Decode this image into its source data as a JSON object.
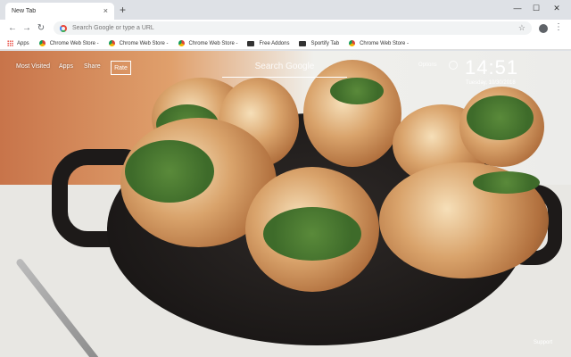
{
  "tab": {
    "title": "New Tab",
    "close": "×",
    "new_tab": "+"
  },
  "window_controls": {
    "minimize": "—",
    "maximize": "☐",
    "close": "✕"
  },
  "toolbar": {
    "back": "←",
    "forward": "→",
    "reload": "↻",
    "omnibox_placeholder": "Search Google or type a URL",
    "star": "☆",
    "menu": "⋮"
  },
  "bookmarks": [
    {
      "label": "Apps",
      "icon": "apps-grid-icon"
    },
    {
      "label": "Chrome Web Store -",
      "icon": "chrome-web-store-icon"
    },
    {
      "label": "Chrome Web Store -",
      "icon": "chrome-web-store-icon"
    },
    {
      "label": "Chrome Web Store -",
      "icon": "chrome-web-store-icon"
    },
    {
      "label": "Free Addons",
      "icon": "addons-icon"
    },
    {
      "label": "Sportify Tab",
      "icon": "sportify-icon"
    },
    {
      "label": "Chrome Web Store -",
      "icon": "chrome-web-store-icon"
    }
  ],
  "newtab": {
    "links": {
      "most_visited": "Most Visited",
      "apps": "Apps",
      "share": "Share",
      "rate": "Rate"
    },
    "search_label": "Search Google",
    "options": "Options",
    "time": "14:51",
    "date": "Tuesday, 10/30/2018",
    "support": "Support"
  }
}
